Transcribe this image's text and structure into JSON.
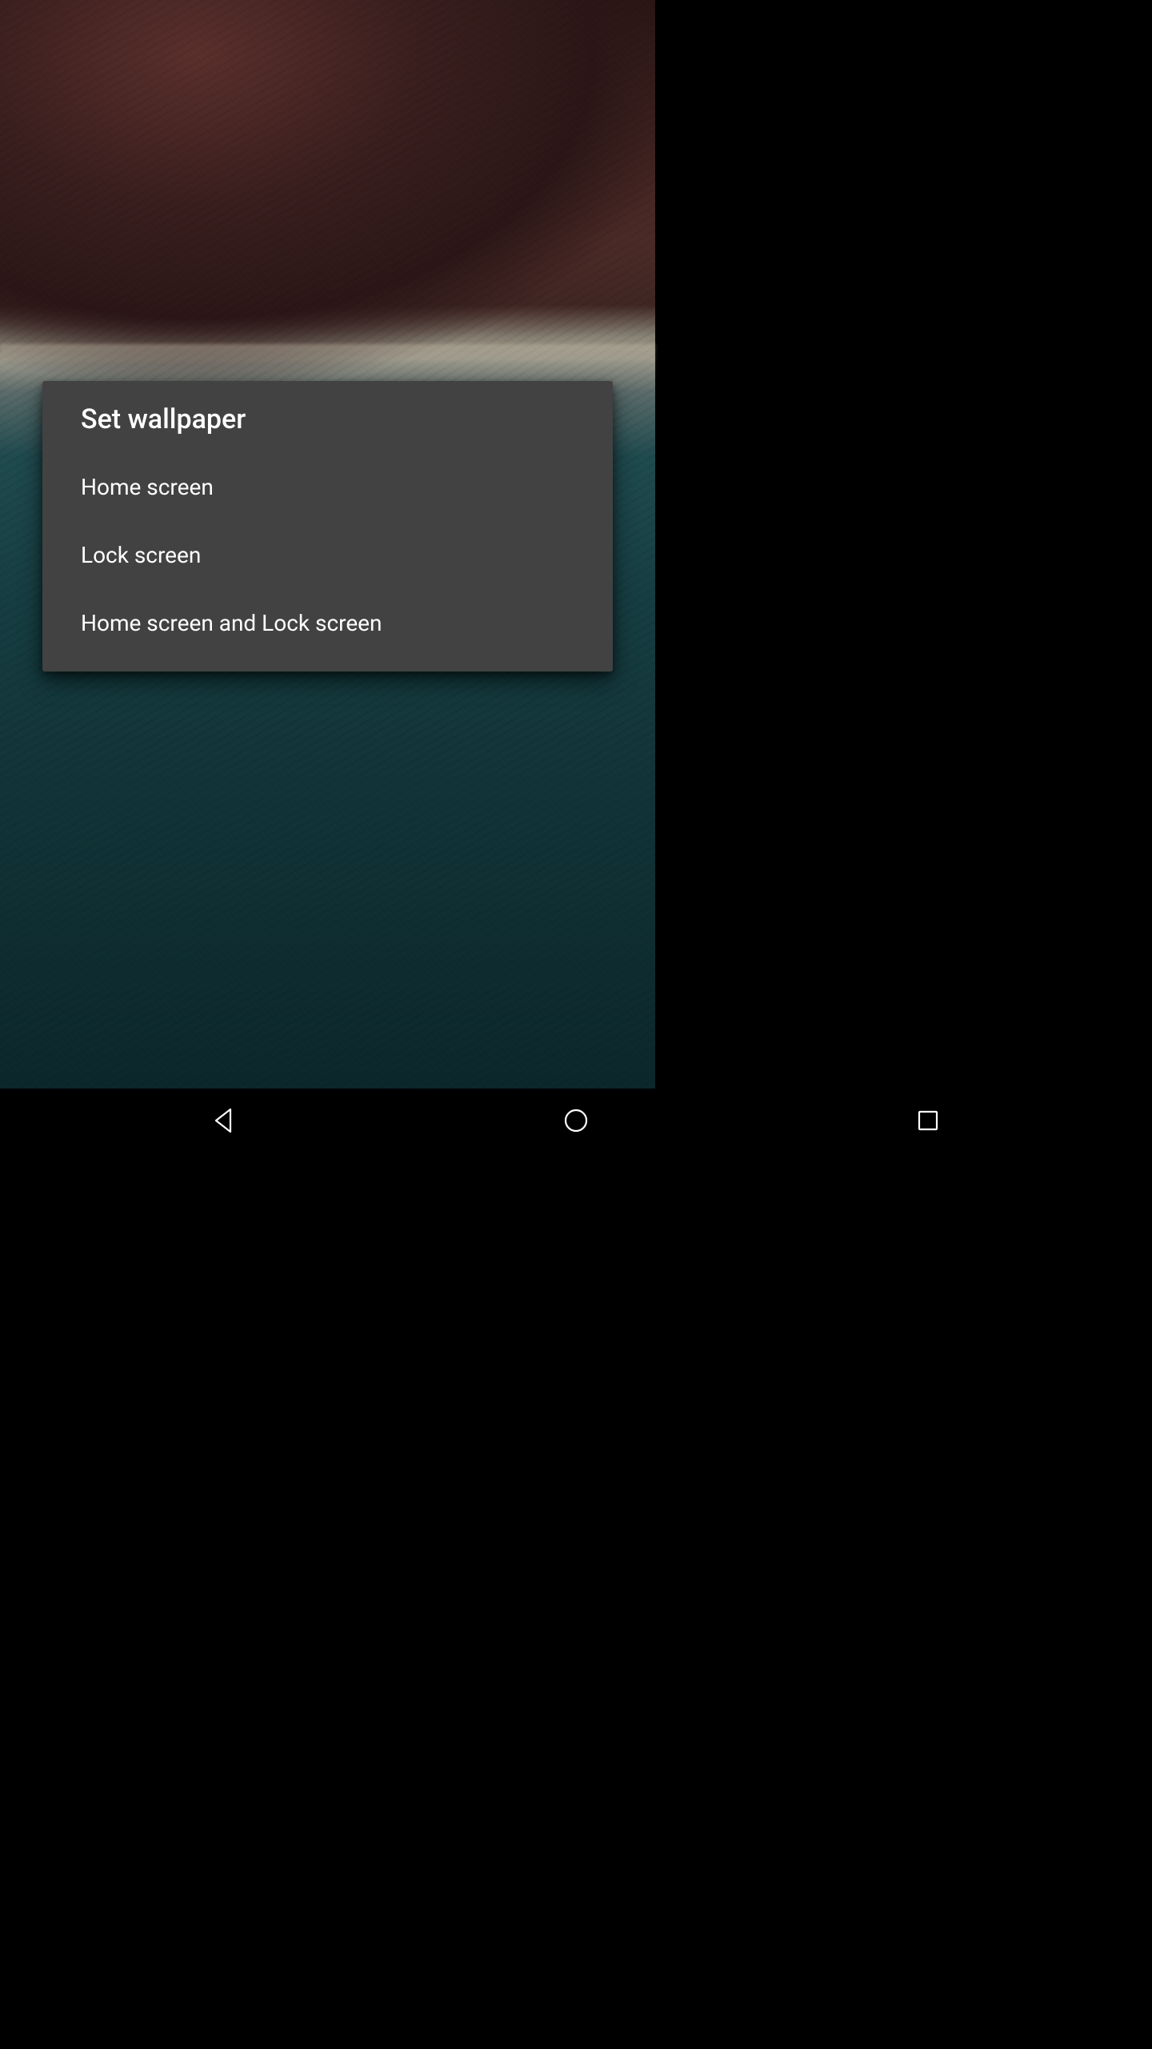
{
  "dialog": {
    "title": "Set wallpaper",
    "options": [
      {
        "label": "Home screen"
      },
      {
        "label": "Lock screen"
      },
      {
        "label": "Home screen and Lock screen"
      }
    ]
  },
  "navbar": {
    "back": "Back",
    "home": "Home",
    "recents": "Recents"
  }
}
